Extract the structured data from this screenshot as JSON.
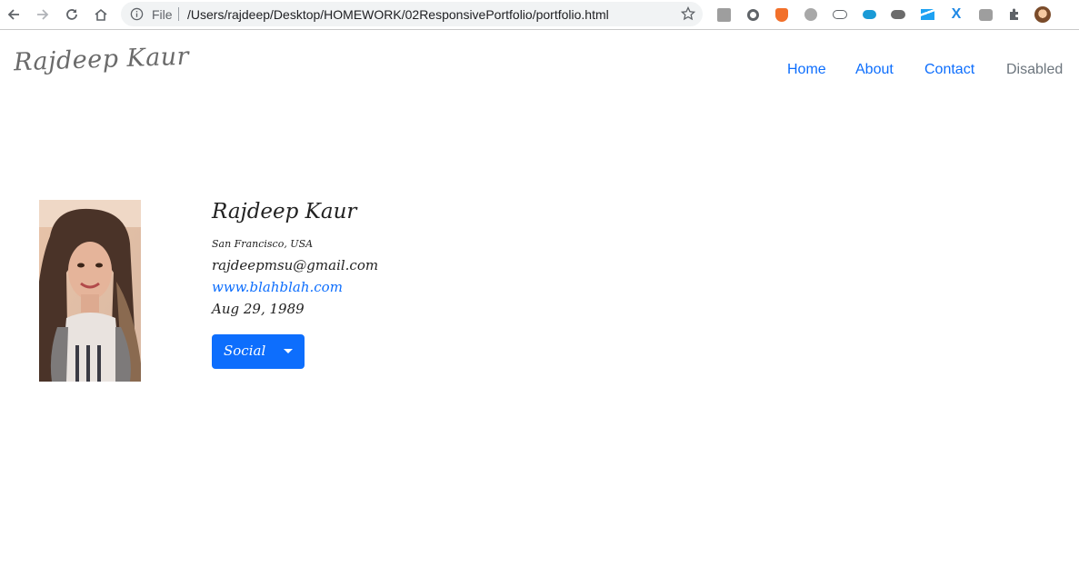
{
  "browser": {
    "file_label": "File",
    "url": "/Users/rajdeep/Desktop/HOMEWORK/02ResponsivePortfolio/portfolio.html",
    "icons": [
      "back-icon",
      "forward-icon",
      "reload-icon",
      "home-icon",
      "info-icon",
      "star-icon",
      "extensions-icon"
    ]
  },
  "navbar": {
    "brand": "Rajdeep Kaur",
    "links": [
      {
        "label": "Home"
      },
      {
        "label": "About"
      },
      {
        "label": "Contact"
      },
      {
        "label": "Disabled"
      }
    ]
  },
  "profile": {
    "name": "Rajdeep Kaur",
    "location": "San Francisco, USA",
    "email": "rajdeepmsu@gmail.com",
    "website": "www.blahblah.com",
    "dob": "Aug 29, 1989",
    "social_button": "Social"
  },
  "colors": {
    "primary": "#0d6efd",
    "disabled": "#6c757d"
  }
}
